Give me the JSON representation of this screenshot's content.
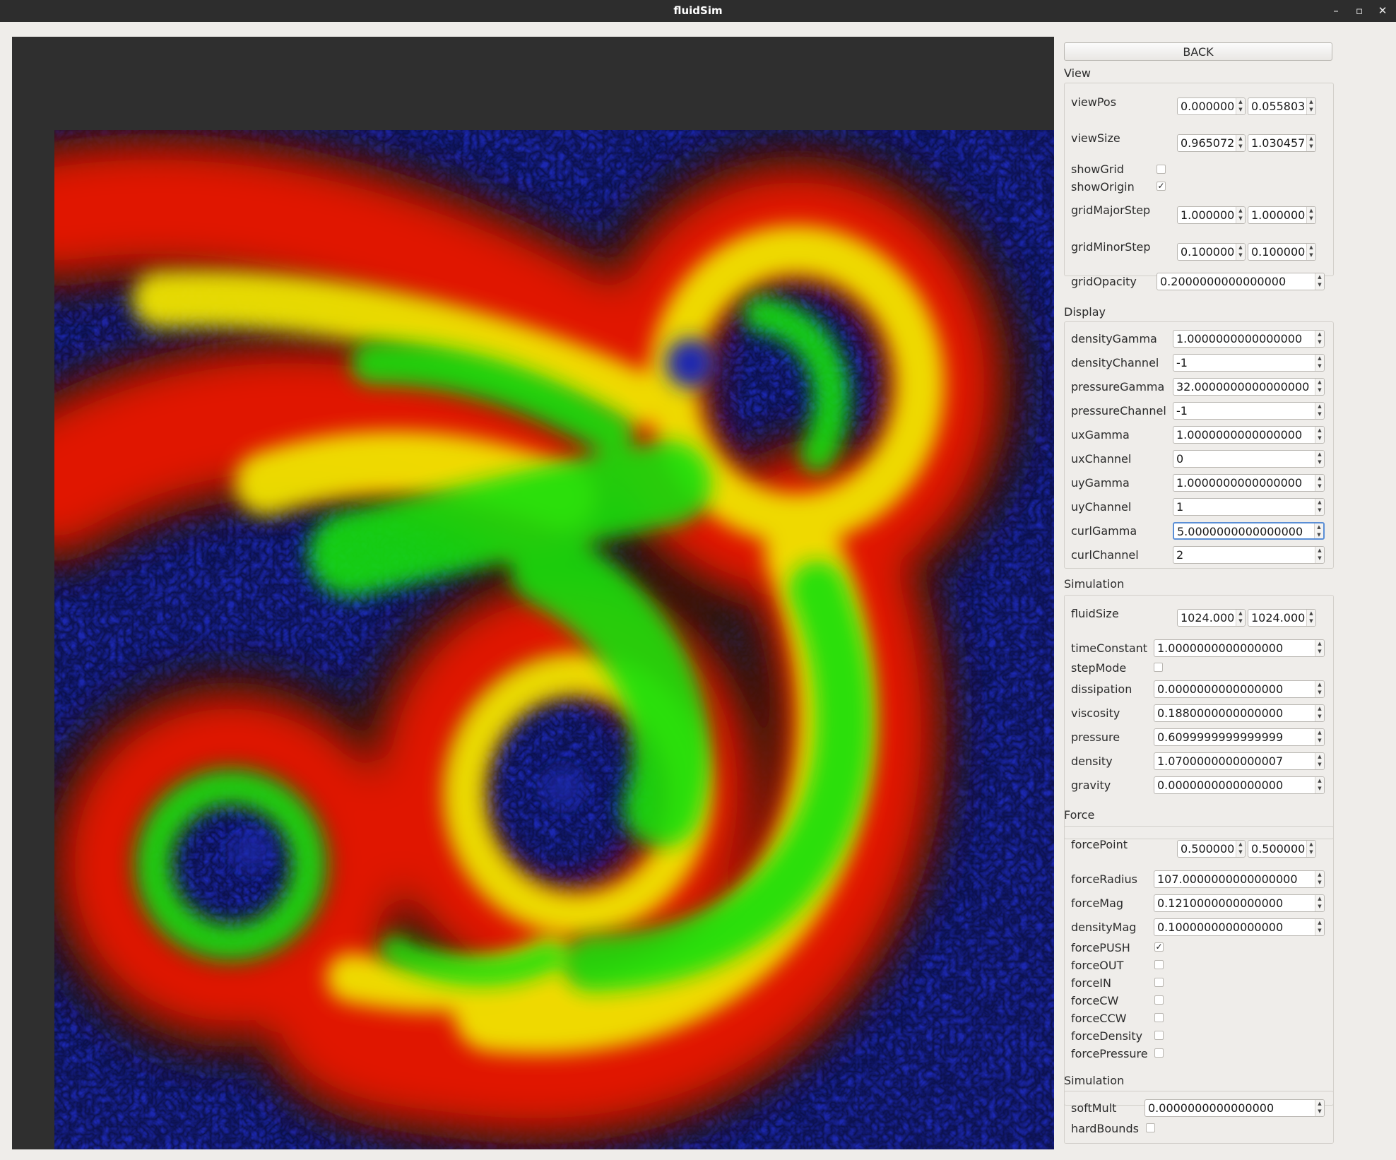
{
  "window": {
    "title": "fluidSim",
    "minimize_icon": "minimize-icon",
    "maximize_icon": "maximize-icon",
    "close_icon": "close-icon"
  },
  "panel": {
    "back_label": "BACK",
    "view": {
      "header": "View",
      "viewPos": {
        "label": "viewPos",
        "x": "0.000000",
        "y": "0.055803"
      },
      "viewSize": {
        "label": "viewSize",
        "x": "0.965072",
        "y": "1.030457"
      },
      "showGrid": {
        "label": "showGrid",
        "checked": false
      },
      "showOrigin": {
        "label": "showOrigin",
        "checked": true
      },
      "gridMajorStep": {
        "label": "gridMajorStep",
        "x": "1.000000",
        "y": "1.000000"
      },
      "gridMinorStep": {
        "label": "gridMinorStep",
        "x": "0.100000",
        "y": "0.100000"
      },
      "gridOpacity": {
        "label": "gridOpacity",
        "value": "0.2000000000000000"
      }
    },
    "display": {
      "header": "Display",
      "fields": [
        {
          "label": "densityGamma",
          "value": "1.0000000000000000"
        },
        {
          "label": "densityChannel",
          "value": "-1"
        },
        {
          "label": "pressureGamma",
          "value": "32.0000000000000000"
        },
        {
          "label": "pressureChannel",
          "value": "-1"
        },
        {
          "label": "uxGamma",
          "value": "1.0000000000000000"
        },
        {
          "label": "uxChannel",
          "value": "0"
        },
        {
          "label": "uyGamma",
          "value": "1.0000000000000000"
        },
        {
          "label": "uyChannel",
          "value": "1"
        },
        {
          "label": "curlGamma",
          "value": "5.0000000000000000"
        },
        {
          "label": "curlChannel",
          "value": "2"
        }
      ]
    },
    "simulation": {
      "header": "Simulation",
      "fluidSize": {
        "label": "fluidSize",
        "x": "1024.000",
        "y": "1024.000"
      },
      "timeConstant": {
        "label": "timeConstant",
        "value": "1.0000000000000000"
      },
      "stepMode": {
        "label": "stepMode",
        "checked": false
      },
      "fields": [
        {
          "label": "dissipation",
          "value": "0.0000000000000000"
        },
        {
          "label": "viscosity",
          "value": "0.1880000000000000"
        },
        {
          "label": "pressure",
          "value": "0.6099999999999999"
        },
        {
          "label": "density",
          "value": "1.0700000000000007"
        },
        {
          "label": "gravity",
          "value": "0.0000000000000000"
        }
      ]
    },
    "force": {
      "header": "Force",
      "forcePoint": {
        "label": "forcePoint",
        "x": "0.500000",
        "y": "0.500000"
      },
      "fields": [
        {
          "label": "forceRadius",
          "value": "107.0000000000000000"
        },
        {
          "label": "forceMag",
          "value": "0.1210000000000000"
        },
        {
          "label": "densityMag",
          "value": "0.1000000000000000"
        }
      ],
      "checks": [
        {
          "label": "forcePUSH",
          "checked": true
        },
        {
          "label": "forceOUT",
          "checked": false
        },
        {
          "label": "forceIN",
          "checked": false
        },
        {
          "label": "forceCW",
          "checked": false
        },
        {
          "label": "forceCCW",
          "checked": false
        },
        {
          "label": "forceDensity",
          "checked": false
        },
        {
          "label": "forcePressure",
          "checked": false
        }
      ]
    },
    "simulation2": {
      "header": "Simulation",
      "softMult": {
        "label": "softMult",
        "value": "0.0000000000000000"
      },
      "hardBounds": {
        "label": "hardBounds",
        "checked": false
      }
    }
  }
}
